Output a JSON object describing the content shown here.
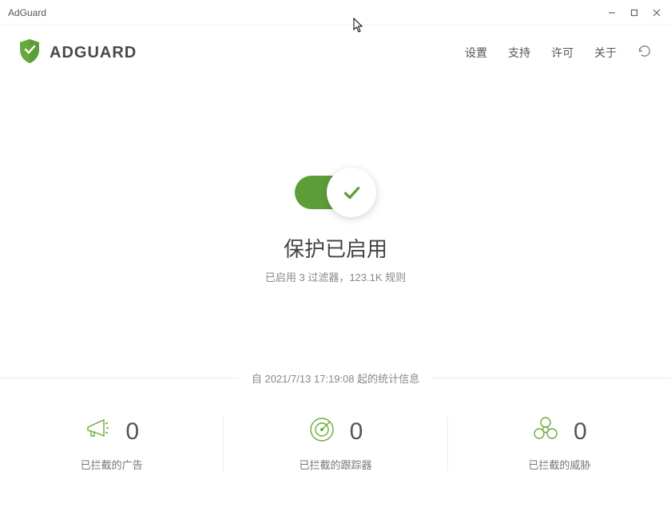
{
  "window": {
    "title": "AdGuard"
  },
  "header": {
    "brand": "ADGUARD",
    "nav": {
      "settings": "设置",
      "support": "支持",
      "license": "许可",
      "about": "关于"
    }
  },
  "main": {
    "status_title": "保护已启用",
    "status_sub": "已启用 3 过滤器，123.1K 规则"
  },
  "stats": {
    "since_label": "自 2021/7/13 17:19:08 起的统计信息",
    "items": [
      {
        "value": "0",
        "label": "已拦截的广告"
      },
      {
        "value": "0",
        "label": "已拦截的跟踪器"
      },
      {
        "value": "0",
        "label": "已拦截的威胁"
      }
    ]
  }
}
